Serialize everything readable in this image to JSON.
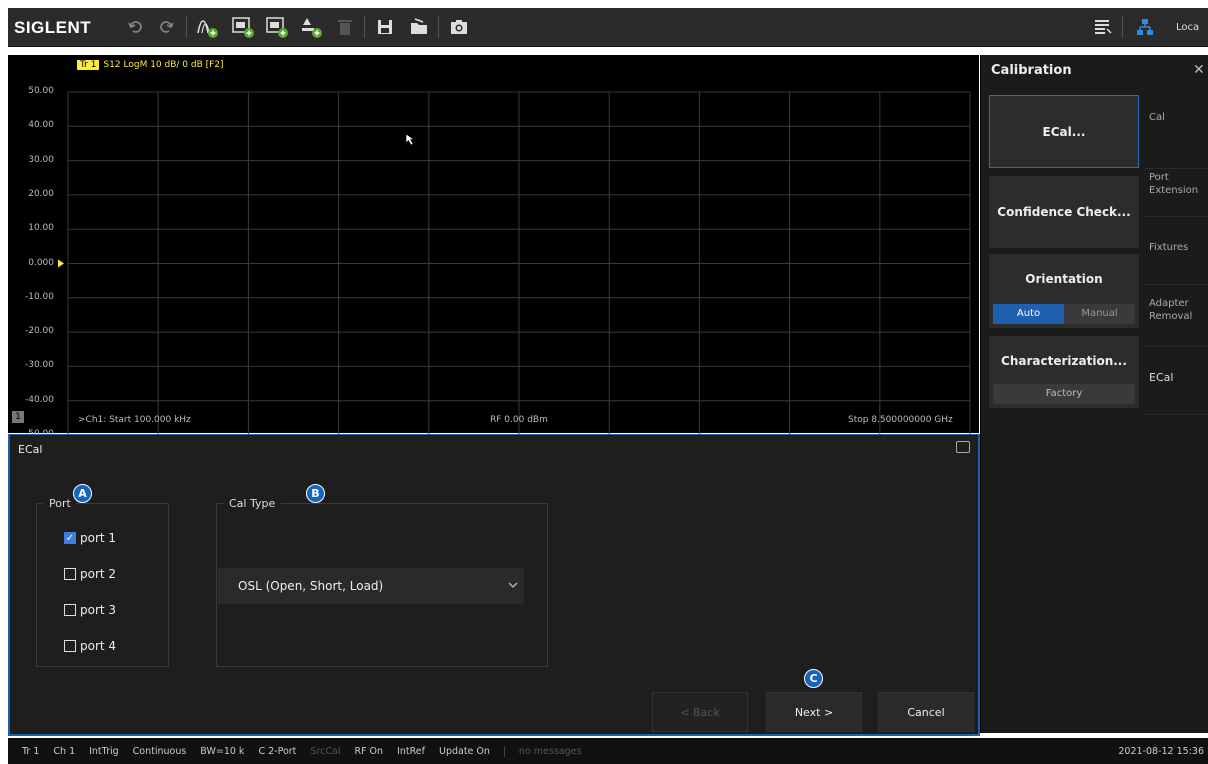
{
  "toolbar": {
    "brand": "SIGLENT",
    "right_label": "Loca"
  },
  "chart": {
    "trace_tag": "Tr 1",
    "trace_desc": "S12 LogM 10 dB/ 0 dB [F2]",
    "y_ticks": [
      "50.00",
      "40.00",
      "30.00",
      "20.00",
      "10.00",
      "0.000",
      "-10.00",
      "-20.00",
      "-30.00",
      "-40.00",
      "-50.00"
    ],
    "channel_badge": "1",
    "start_label": ">Ch1: Start 100.000 kHz",
    "power_label": "RF 0.00 dBm",
    "stop_label": "Stop 8.500000000 GHz",
    "trace_color": "#ffeb3b",
    "grid_color": "#3a3a3a"
  },
  "calibration_panel": {
    "title": "Calibration",
    "close": "✕",
    "ecal_button": "ECal...",
    "confidence_button": "Confidence Check...",
    "orientation_label": "Orientation",
    "orientation_auto": "Auto",
    "orientation_manual": "Manual",
    "characterization_label": "Characterization...",
    "characterization_value": "Factory",
    "side_tabs": [
      "Cal",
      "Port Extension",
      "Fixtures",
      "Adapter Removal",
      "ECal"
    ]
  },
  "dialog": {
    "title": "ECal",
    "port_legend": "Port",
    "ports": [
      {
        "label": "port 1",
        "checked": true
      },
      {
        "label": "port 2",
        "checked": false
      },
      {
        "label": "port 3",
        "checked": false
      },
      {
        "label": "port 4",
        "checked": false
      }
    ],
    "caltype_legend": "Cal Type",
    "caltype_value": "OSL (Open, Short, Load)",
    "markers": [
      "A",
      "B",
      "C"
    ],
    "back": "< Back",
    "next": "Next >",
    "cancel": "Cancel"
  },
  "status_bar": {
    "items": [
      "Tr 1",
      "Ch 1",
      "IntTrig",
      "Continuous",
      "BW=10 k",
      "C 2-Port",
      "SrcCal",
      "RF On",
      "IntRef",
      "Update On",
      "no messages"
    ],
    "datetime": "2021-08-12 15:36"
  }
}
